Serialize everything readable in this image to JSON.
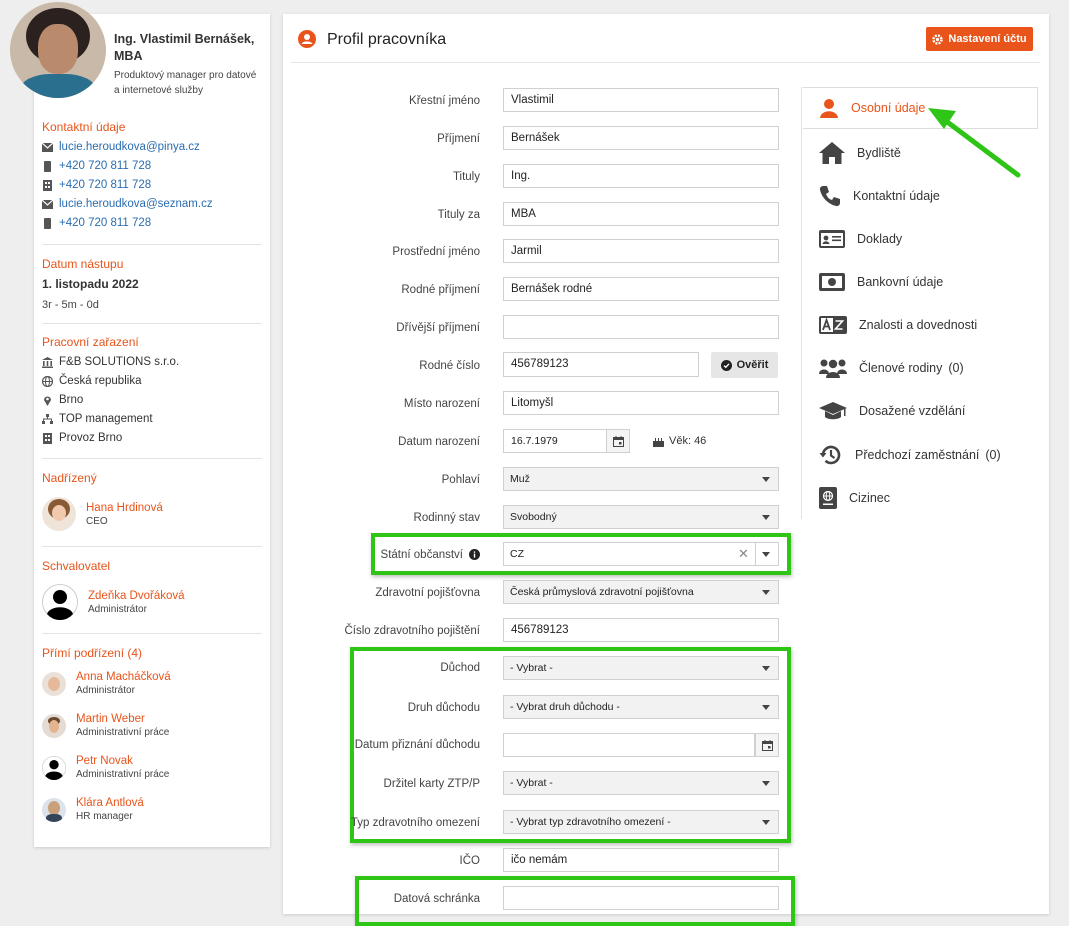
{
  "profile": {
    "name_line1": "Ing. Vlastimil Bernášek,",
    "name_line2": "MBA",
    "position_line1": "Produktový manager pro datové",
    "position_line2": "a internetové služby"
  },
  "contact": {
    "title": "Kontaktní údaje",
    "email1": "lucie.heroudkova@pinya.cz",
    "phone1": "+420 720 811 728",
    "phone2": "+420 720 811 728",
    "email2": "lucie.heroudkova@seznam.cz",
    "phone3": "+420 720 811 728"
  },
  "start": {
    "title": "Datum nástupu",
    "date": "1. listopadu 2022",
    "duration": "3r - 5m - 0d"
  },
  "assignment": {
    "title": "Pracovní zařazení",
    "company": "F&B SOLUTIONS s.r.o.",
    "country": "Česká republika",
    "city": "Brno",
    "level": "TOP management",
    "unit": "Provoz Brno"
  },
  "superior": {
    "title": "Nadřízený",
    "name": "Hana Hrdinová",
    "role": "CEO"
  },
  "approver": {
    "title": "Schvalovatel",
    "name": "Zdeňka Dvořáková",
    "role": "Administrátor"
  },
  "subordinates": {
    "title": "Přímí podřízení (4)",
    "items": [
      {
        "name": "Anna Macháčková",
        "role": "Administrátor"
      },
      {
        "name": "Martin Weber",
        "role": "Administrativní práce"
      },
      {
        "name": "Petr Novak",
        "role": "Administrativní práce"
      },
      {
        "name": "Klára Antlová",
        "role": "HR manager"
      }
    ]
  },
  "header": {
    "title": "Profil pracovníka",
    "settings_button": "Nastavení účtu"
  },
  "form": {
    "first_name": {
      "label": "Křestní jméno",
      "value": "Vlastimil"
    },
    "surname": {
      "label": "Příjmení",
      "value": "Bernášek"
    },
    "titles": {
      "label": "Tituly",
      "value": "Ing."
    },
    "titles_after": {
      "label": "Tituly za",
      "value": "MBA"
    },
    "middle_name": {
      "label": "Prostřední jméno",
      "value": "Jarmil"
    },
    "birth_surname": {
      "label": "Rodné příjmení",
      "value": "Bernášek rodné"
    },
    "former_surname": {
      "label": "Dřívější příjmení",
      "value": ""
    },
    "birth_number": {
      "label": "Rodné číslo",
      "value": "456789123",
      "verify_button": "Ověřit"
    },
    "birth_place": {
      "label": "Místo narození",
      "value": "Litomyšl"
    },
    "birth_date": {
      "label": "Datum narození",
      "value": "16.7.1979",
      "age": "Věk: 46"
    },
    "gender": {
      "label": "Pohlaví",
      "value": "Muž"
    },
    "marital": {
      "label": "Rodinný stav",
      "value": "Svobodný"
    },
    "citizenship": {
      "label": "Státní občanství",
      "value": "CZ"
    },
    "insurer": {
      "label": "Zdravotní pojišťovna",
      "value": "Česká průmyslová zdravotní pojišťovna"
    },
    "insurance_no": {
      "label": "Číslo zdravotního pojištění",
      "value": "456789123"
    },
    "pension": {
      "label": "Důchod",
      "value": "- Vybrat -"
    },
    "pension_type": {
      "label": "Druh důchodu",
      "value": "- Vybrat druh důchodu -"
    },
    "pension_date": {
      "label": "Datum přiznání důchodu",
      "value": ""
    },
    "ztp": {
      "label": "Držitel karty ZTP/P",
      "value": "- Vybrat -"
    },
    "health_limit": {
      "label": "Typ zdravotního omezení",
      "value": "- Vybrat typ zdravotního omezení -"
    },
    "ico": {
      "label": "IČO",
      "value": "ičo nemám"
    },
    "databox": {
      "label": "Datová schránka",
      "value": ""
    }
  },
  "menu": {
    "items": [
      {
        "label": "Osobní údaje",
        "icon": "user-icon"
      },
      {
        "label": "Bydliště",
        "icon": "home-icon"
      },
      {
        "label": "Kontaktní údaje",
        "icon": "phone-icon"
      },
      {
        "label": "Doklady",
        "icon": "id-card-icon"
      },
      {
        "label": "Bankovní údaje",
        "icon": "money-icon"
      },
      {
        "label": "Znalosti a dovednosti",
        "icon": "language-icon"
      },
      {
        "label": "Členové rodiny",
        "count": "(0)",
        "icon": "family-icon"
      },
      {
        "label": "Dosažené vzdělání",
        "icon": "graduation-cap-icon"
      },
      {
        "label": "Předchozí zaměstnání",
        "count": "(0)",
        "icon": "history-icon"
      },
      {
        "label": "Cizinec",
        "icon": "passport-icon"
      }
    ]
  },
  "colors": {
    "accent": "#e8541a",
    "link": "#2a6db0",
    "highlight": "#2ec516"
  }
}
